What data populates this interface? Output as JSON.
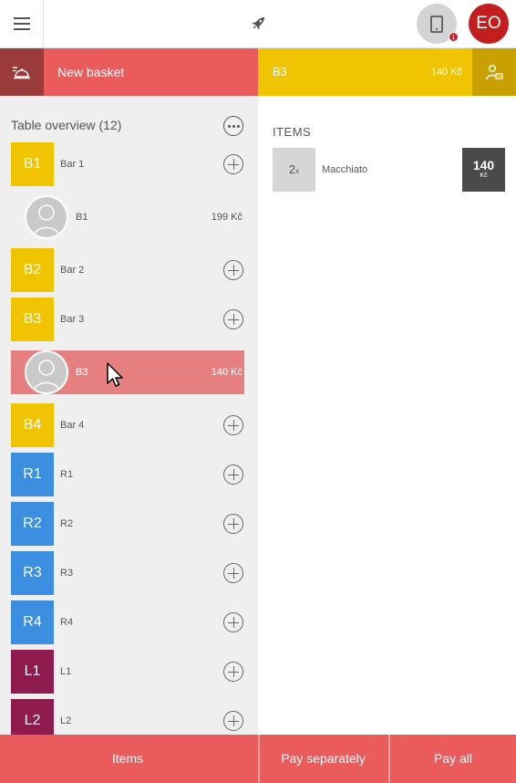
{
  "colors": {
    "accent": "#ea5c5c",
    "bar": "#f0c400",
    "restaurant": "#3b8ee0",
    "lounge": "#8e1a4e",
    "avatar": "#c31e1e"
  },
  "header": {
    "menu_icon": "hamburger-icon",
    "logo_icon": "rocket-icon",
    "tablet_icon": "tablet-icon",
    "notification_count": "1",
    "user_initials": "EO"
  },
  "basket": {
    "icon": "tray-icon",
    "label": "New basket"
  },
  "order": {
    "name": "B3",
    "total": "140 Kč",
    "icon": "user-edit-icon"
  },
  "overview": {
    "title": "Table overview (12)",
    "rows": [
      {
        "type": "table",
        "code": "B1",
        "name": "Bar 1",
        "group": "bar"
      },
      {
        "type": "guest",
        "name": "B1",
        "amount": "199 Kč"
      },
      {
        "type": "table",
        "code": "B2",
        "name": "Bar 2",
        "group": "bar"
      },
      {
        "type": "table",
        "code": "B3",
        "name": "Bar 3",
        "group": "bar"
      },
      {
        "type": "guest",
        "name": "B3",
        "amount": "140 Kč",
        "selected": true
      },
      {
        "type": "table",
        "code": "B4",
        "name": "Bar 4",
        "group": "bar"
      },
      {
        "type": "table",
        "code": "R1",
        "name": "R1",
        "group": "restaurant"
      },
      {
        "type": "table",
        "code": "R2",
        "name": "R2",
        "group": "restaurant"
      },
      {
        "type": "table",
        "code": "R3",
        "name": "R3",
        "group": "restaurant"
      },
      {
        "type": "table",
        "code": "R4",
        "name": "R4",
        "group": "restaurant"
      },
      {
        "type": "table",
        "code": "L1",
        "name": "L1",
        "group": "lounge"
      },
      {
        "type": "table",
        "code": "L2",
        "name": "L2",
        "group": "lounge"
      }
    ]
  },
  "items_panel": {
    "heading": "ITEMS",
    "items": [
      {
        "qty": "2",
        "qty_unit": "x",
        "name": "Macchiato",
        "price": "140",
        "currency": "Kč"
      }
    ]
  },
  "footer": {
    "items_label": "Items",
    "pay_separately_label": "Pay separately",
    "pay_all_label": "Pay all"
  }
}
